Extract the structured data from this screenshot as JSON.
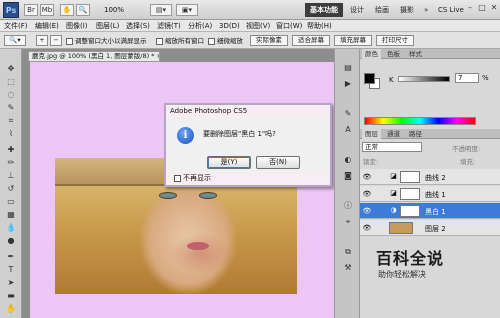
{
  "app": {
    "logo": "Ps",
    "zoom": "100%",
    "workspace_active": "基本功能",
    "workspaces": [
      "设计",
      "绘画",
      "摄影"
    ],
    "cs_live": "CS Live",
    "window_controls": {
      "minimize": "–",
      "restore": "□",
      "close": "✕"
    }
  },
  "menu": {
    "items": [
      "文件(F)",
      "编辑(E)",
      "图像(I)",
      "图层(L)",
      "选择(S)",
      "滤镜(T)",
      "分析(A)",
      "3D(D)",
      "视图(V)",
      "窗口(W)",
      "帮助(H)"
    ]
  },
  "options": {
    "check1": "调整窗口大小以满屏显示",
    "check2": "缩放所有窗口",
    "check3": "细微缩放",
    "btn_actual": "实际像素",
    "btn_fit": "适合屏幕",
    "btn_fill": "填充屏幕",
    "btn_print": "打印尺寸"
  },
  "document": {
    "tab": "蘑克.jpg @ 100% (黑白 1, 图层蒙版/8) * ×"
  },
  "dialog": {
    "title": "Adobe Photoshop CS5",
    "icon": "i",
    "message": "要删除图层\"黑白 1\"吗?",
    "yes": "是(Y)",
    "no": "否(N)",
    "dont_show": "不再显示"
  },
  "color_panel": {
    "tabs": [
      "颜色",
      "色板",
      "样式"
    ],
    "k_label": "K",
    "k_value": "7",
    "k_pct": "%"
  },
  "layers_panel": {
    "tabs": [
      "图层",
      "通道",
      "路径"
    ],
    "blend": "正常",
    "opacity_label": "不透明度:",
    "lock_label": "锁定:",
    "fill_label": "填充:",
    "layers": [
      {
        "name": "曲线 2",
        "visible": true,
        "selected": false
      },
      {
        "name": "曲线 1",
        "visible": true,
        "selected": false
      },
      {
        "name": "黑白 1",
        "visible": true,
        "selected": true
      },
      {
        "name": "图层 2",
        "visible": true,
        "selected": false
      }
    ]
  },
  "watermark": {
    "title": "百科全说",
    "subtitle": "助你轻松解决"
  }
}
